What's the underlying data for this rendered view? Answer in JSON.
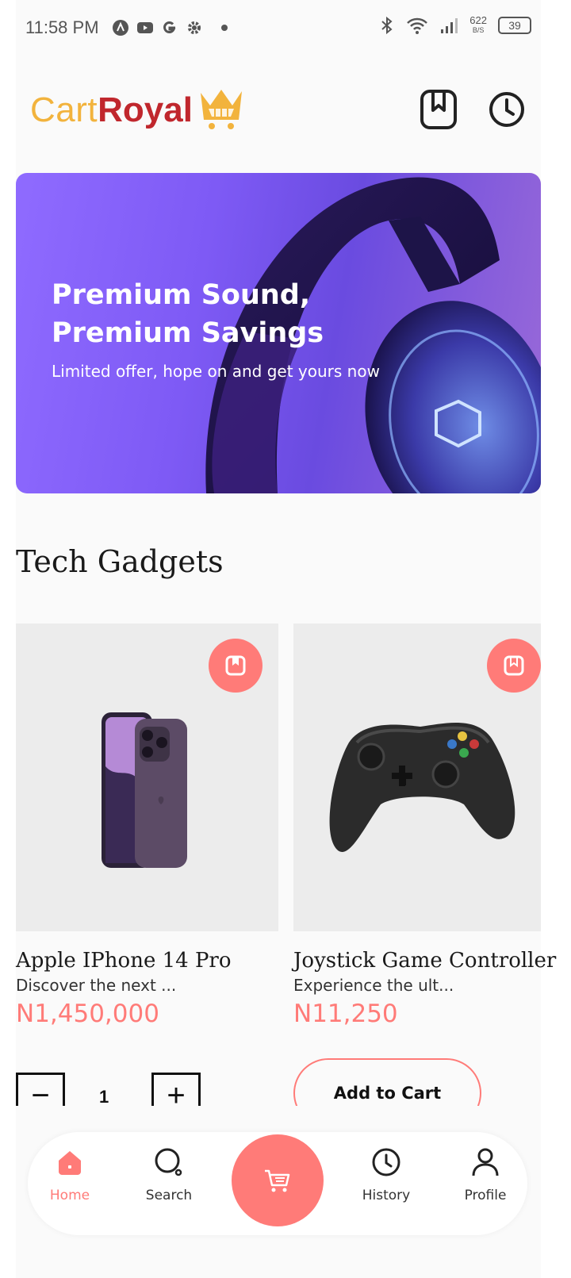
{
  "status_bar": {
    "time": "11:58 PM",
    "net_speed": "622",
    "net_unit": "B/S",
    "battery": "39"
  },
  "header": {
    "logo_part1": "Cart",
    "logo_part2": "Royal",
    "bookmark_icon": "bookmark-icon",
    "history_icon": "clock-icon"
  },
  "banner": {
    "title": "Premium Sound, Premium Savings",
    "subtitle": "Limited offer, hope on and get yours now"
  },
  "section": {
    "title": "Tech Gadgets"
  },
  "products": [
    {
      "name": "Apple IPhone 14 Pro",
      "description": "Discover the next ...",
      "price": "N1,450,000",
      "quantity": "1",
      "minus": "−",
      "plus": "+"
    },
    {
      "name": "Joystick Game Controller",
      "description": "Experience the ult...",
      "price": "N11,250",
      "add_label": "Add to Cart"
    }
  ],
  "nav": {
    "items": [
      {
        "label": "Home",
        "icon": "home-icon",
        "active": true
      },
      {
        "label": "Search",
        "icon": "search-icon"
      },
      {
        "label": "History",
        "icon": "clock-icon"
      },
      {
        "label": "Profile",
        "icon": "user-icon"
      }
    ],
    "cart_icon": "cart-icon"
  },
  "colors": {
    "accent": "#ff7b78",
    "logo_yellow": "#f2b33d",
    "logo_red": "#c0272d",
    "banner_purple": "#7e5af5"
  }
}
